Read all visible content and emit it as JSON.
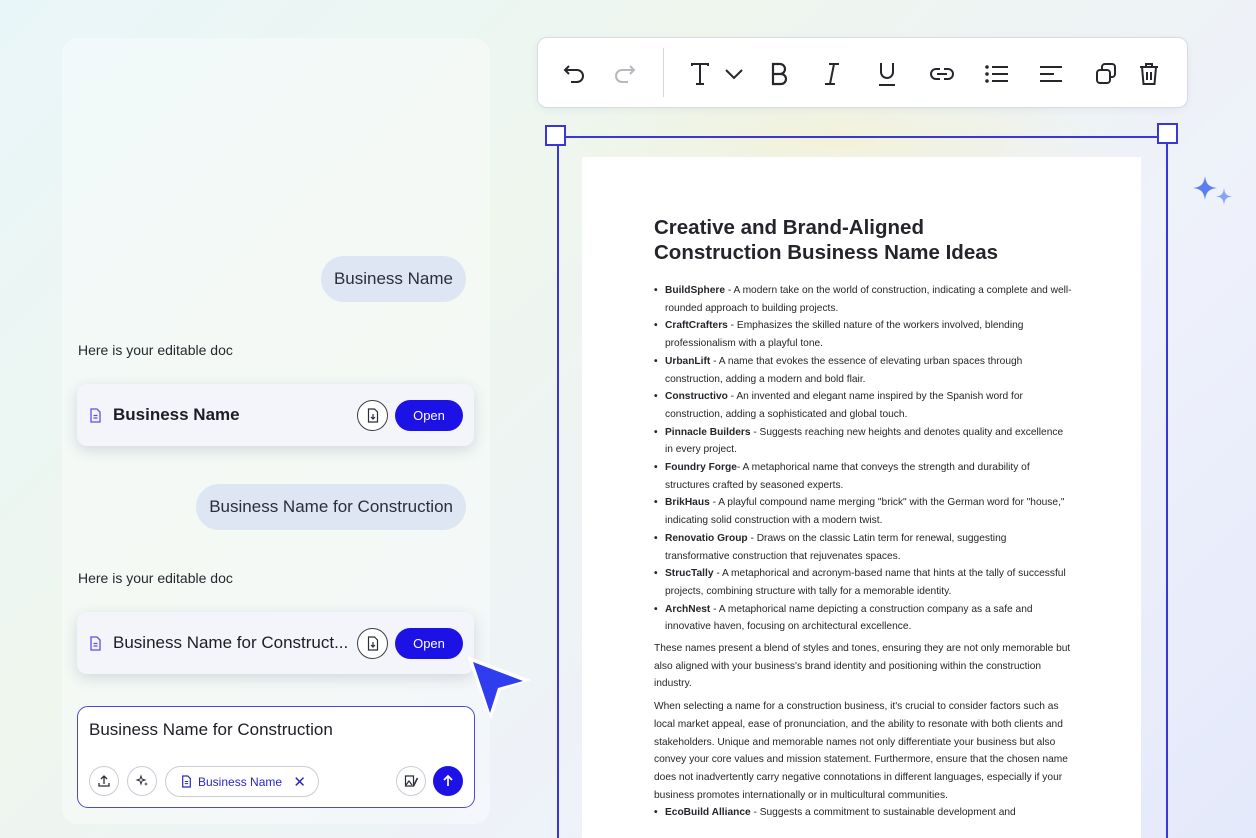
{
  "chat": {
    "messages": [
      {
        "role": "user",
        "text": "Business Name"
      },
      {
        "role": "assistant",
        "text": "Here is your editable doc",
        "doc_title": "Business Name",
        "open_label": "Open"
      },
      {
        "role": "user",
        "text": "Business Name for Construction"
      },
      {
        "role": "assistant",
        "text": "Here is your editable doc",
        "doc_title": "Business Name for Construct...",
        "open_label": "Open"
      }
    ],
    "composer": {
      "text": "Business Name for Construction",
      "chip_label": "Business Name",
      "chip_close": "✕"
    }
  },
  "toolbar": {
    "icons": [
      "undo-icon",
      "redo-icon",
      "text-style-icon",
      "chevron-down-icon",
      "bold-icon",
      "italic-icon",
      "underline-icon",
      "link-icon",
      "bulleted-list-icon",
      "align-icon",
      "duplicate-icon",
      "delete-icon"
    ]
  },
  "document": {
    "title": "Creative and Brand-Aligned Construction Business Name Ideas",
    "ideas": [
      {
        "name": "BuildSphere",
        "desc": " - A modern take on the world of construction, indicating a complete and well-rounded approach to building projects."
      },
      {
        "name": "CraftCrafters",
        "desc": " - Emphasizes the skilled nature of the workers involved, blending professionalism with a playful tone."
      },
      {
        "name": "UrbanLift",
        "desc": " - A name that evokes the essence of elevating urban spaces through construction, adding a modern and bold flair."
      },
      {
        "name": "Constructivo",
        "desc": " - An invented and elegant name inspired by the Spanish word for construction, adding a sophisticated and global touch."
      },
      {
        "name": "Pinnacle Builders",
        "desc": " - Suggests reaching new heights and denotes quality and excellence in every project."
      },
      {
        "name": "Foundry Forge",
        "desc": "- A metaphorical name that conveys the strength and durability of structures crafted by seasoned experts."
      },
      {
        "name": "BrikHaus",
        "desc": " - A playful compound name merging \"brick\" with the German word for \"house,\" indicating solid construction with a modern twist."
      },
      {
        "name": "Renovatio Group",
        "desc": " - Draws on the classic Latin term for renewal, suggesting transformative construction that rejuvenates spaces."
      },
      {
        "name": "StrucTally",
        "desc": " - A metaphorical and acronym-based name that hints at the tally of successful projects, combining structure with tally for a memorable identity."
      },
      {
        "name": "ArchNest",
        "desc": " - A metaphorical name depicting a construction company as a safe and innovative haven, focusing on architectural excellence."
      }
    ],
    "paragraph1": "These names present a blend of styles and tones, ensuring they are not only memorable but also aligned with your business's brand identity and positioning within the construction industry.",
    "paragraph2": "When selecting a name for a construction business, it's crucial to consider factors such as local market appeal, ease of pronunciation, and the ability to resonate with both clients and stakeholders. Unique and memorable names not only differentiate your business but also convey your core values and mission statement. Furthermore, ensure that the chosen name does not inadvertently carry negative connotations in different languages, especially if your business promotes internationally or in multicultural communities.",
    "extra_ideas": [
      {
        "name": "EcoBuild Alliance",
        "desc": " - Suggests a commitment to sustainable development and"
      }
    ]
  },
  "colors": {
    "accent": "#1d12e6",
    "frame": "#3a37d6",
    "bubble": "#dde6f2"
  }
}
